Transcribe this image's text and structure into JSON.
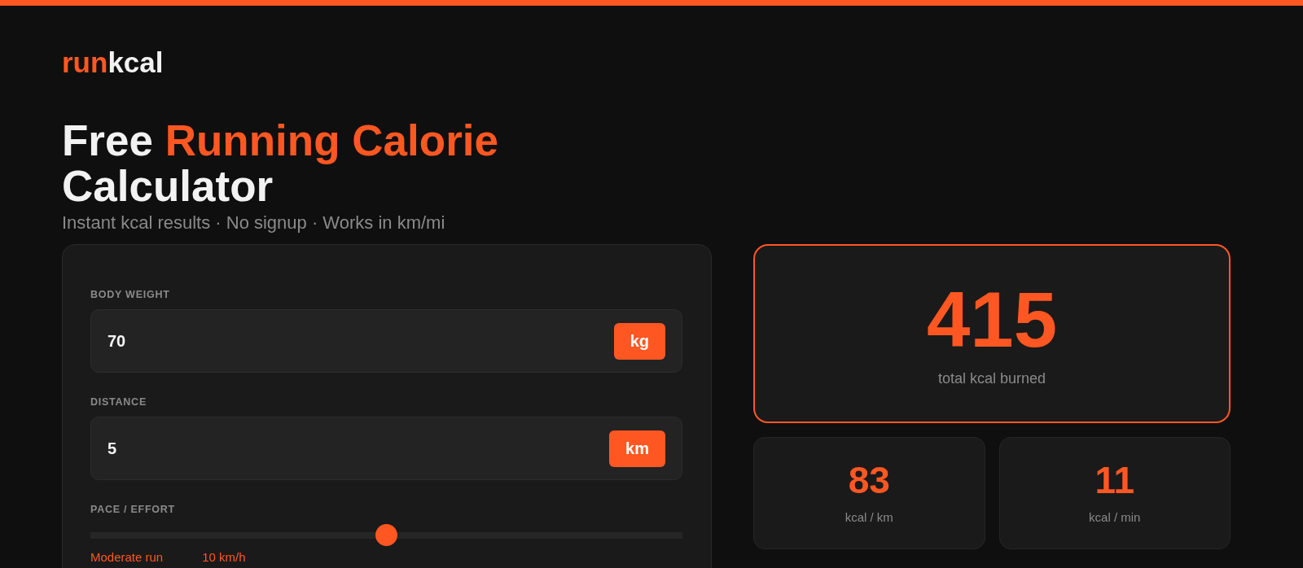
{
  "logo": {
    "parts": [
      {
        "text": "run",
        "accent": true
      },
      {
        "text": "kcal",
        "accent": false
      }
    ]
  },
  "heading": {
    "parts": [
      {
        "text": "Free",
        "accent": false
      },
      {
        "text": "Running Calorie",
        "accent": true
      },
      {
        "text": "Calculator",
        "accent": false
      }
    ]
  },
  "subtitle": "Instant kcal results · No signup · Works in km/mi",
  "form": {
    "fields": [
      {
        "kind": "number",
        "label": "BODY WEIGHT",
        "value": "70",
        "unit": "kg"
      },
      {
        "kind": "number",
        "label": "DISTANCE",
        "value": "5",
        "unit": "km"
      },
      {
        "kind": "slider",
        "label": "PACE / EFFORT",
        "level": 0.5,
        "effort": "Moderate run",
        "pace": "10 km/h"
      }
    ]
  },
  "results": {
    "total": {
      "value": "415",
      "label": "total kcal burned"
    },
    "stats": [
      {
        "value": "83",
        "label": "kcal / km"
      },
      {
        "value": "11",
        "label": "kcal / min"
      }
    ]
  }
}
